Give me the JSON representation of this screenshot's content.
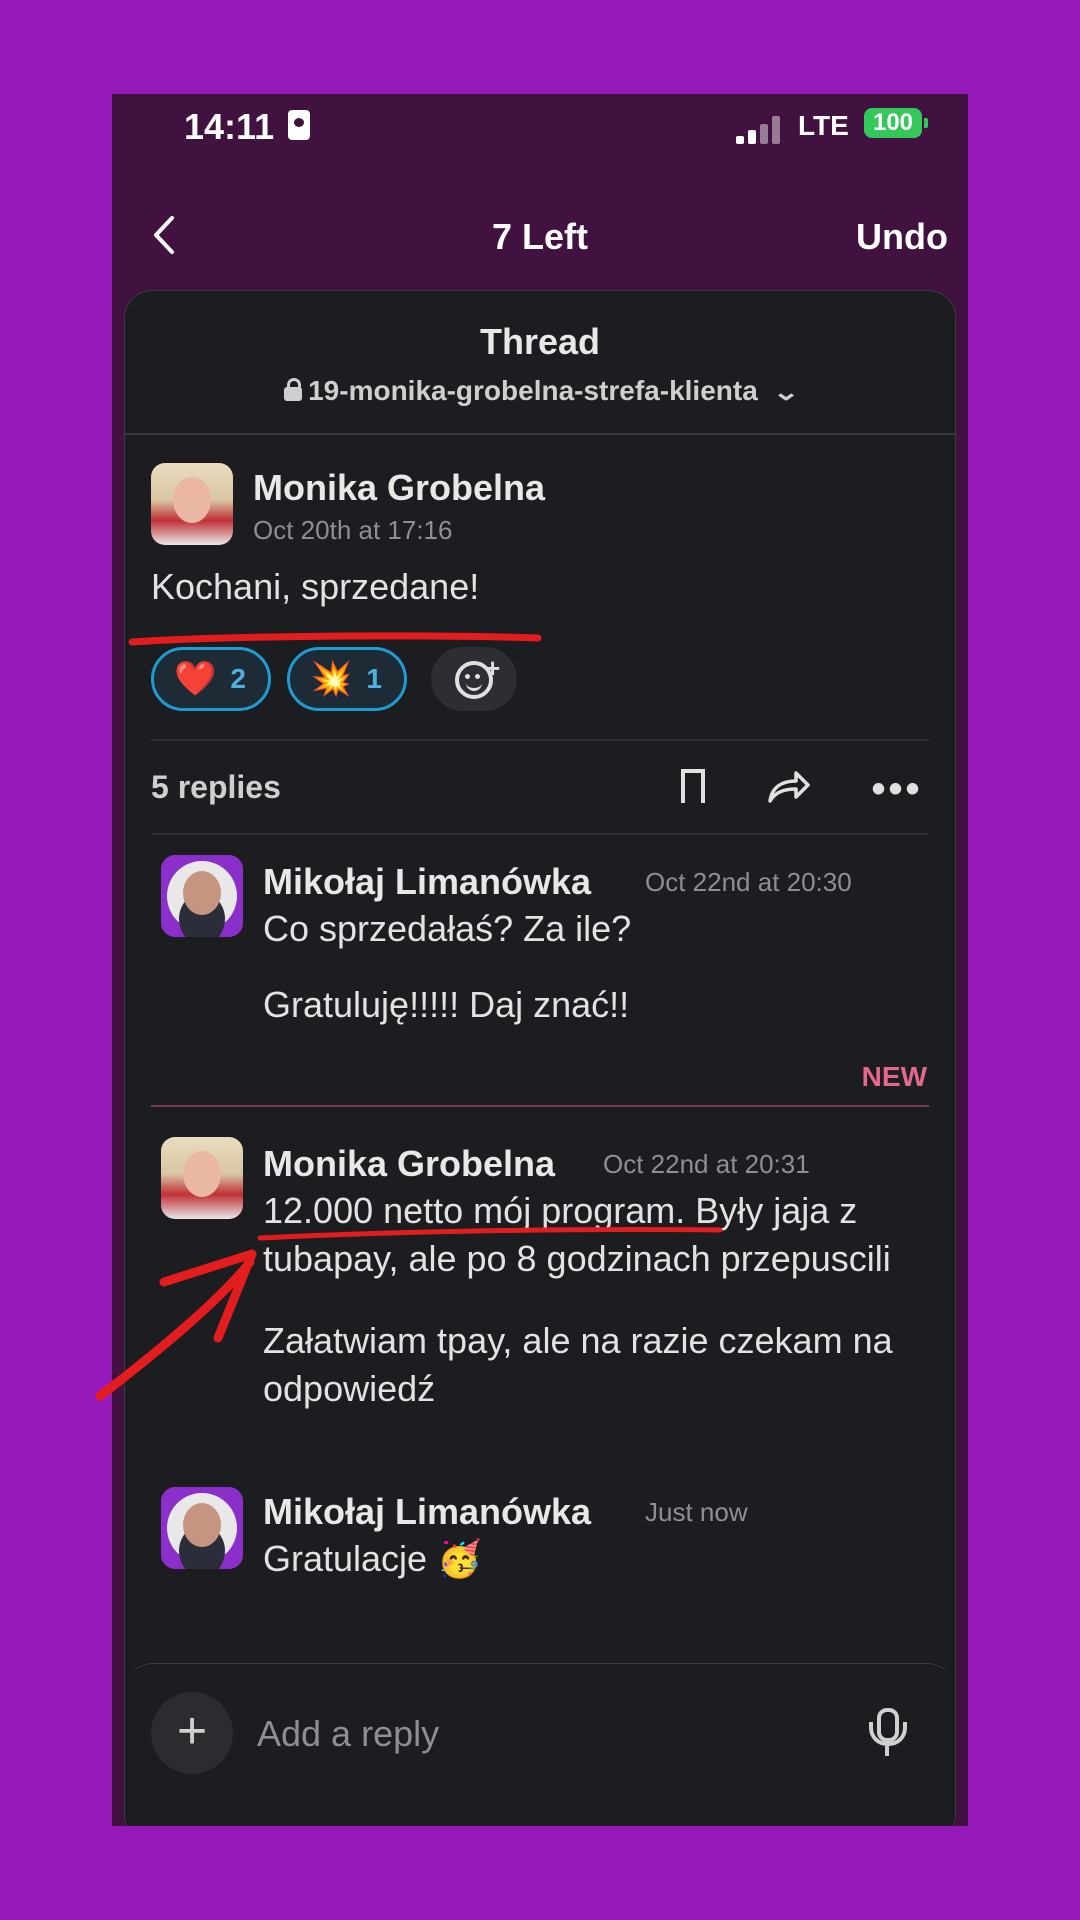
{
  "status": {
    "time": "14:11",
    "network": "LTE",
    "battery": "100"
  },
  "nav": {
    "back_icon": "chevron-left-icon",
    "title": "7 Left",
    "undo": "Undo"
  },
  "thread": {
    "title": "Thread",
    "channel": "19-monika-grobelna-strefa-klienta"
  },
  "parent": {
    "author": "Monika Grobelna",
    "time": "Oct 20th at 17:16",
    "text": "Kochani, sprzedane!",
    "reactions": [
      {
        "emoji": "❤️",
        "count": "2"
      },
      {
        "emoji": "💥",
        "count": "1"
      }
    ]
  },
  "replies_bar": {
    "count_label": "5 replies"
  },
  "new_label": "NEW",
  "messages": [
    {
      "author": "Mikołaj Limanówka",
      "time": "Oct 22nd at 20:30",
      "lines": [
        "Co sprzedałaś? Za ile?",
        "Gratuluję!!!!! Daj znać!!"
      ]
    },
    {
      "author": "Monika Grobelna",
      "time": "Oct 22nd at 20:31",
      "lines": [
        "12.000 netto mój program.  Były jaja z tubapay, ale po 8 godzinach przepuscili",
        "Załatwiam tpay, ale na razie czekam na odpowiedź"
      ]
    },
    {
      "author": "Mikołaj Limanówka",
      "time": "Just now",
      "lines": [
        "Gratulacje 🥳"
      ]
    }
  ],
  "composer": {
    "placeholder": "Add a reply",
    "plus": "+"
  },
  "colors": {
    "background": "#9619b9",
    "header": "#41123f",
    "card": "#1b1d21",
    "reaction_border": "#1f9bd1",
    "new": "#e3688a",
    "annotation": "#e31d1d"
  }
}
